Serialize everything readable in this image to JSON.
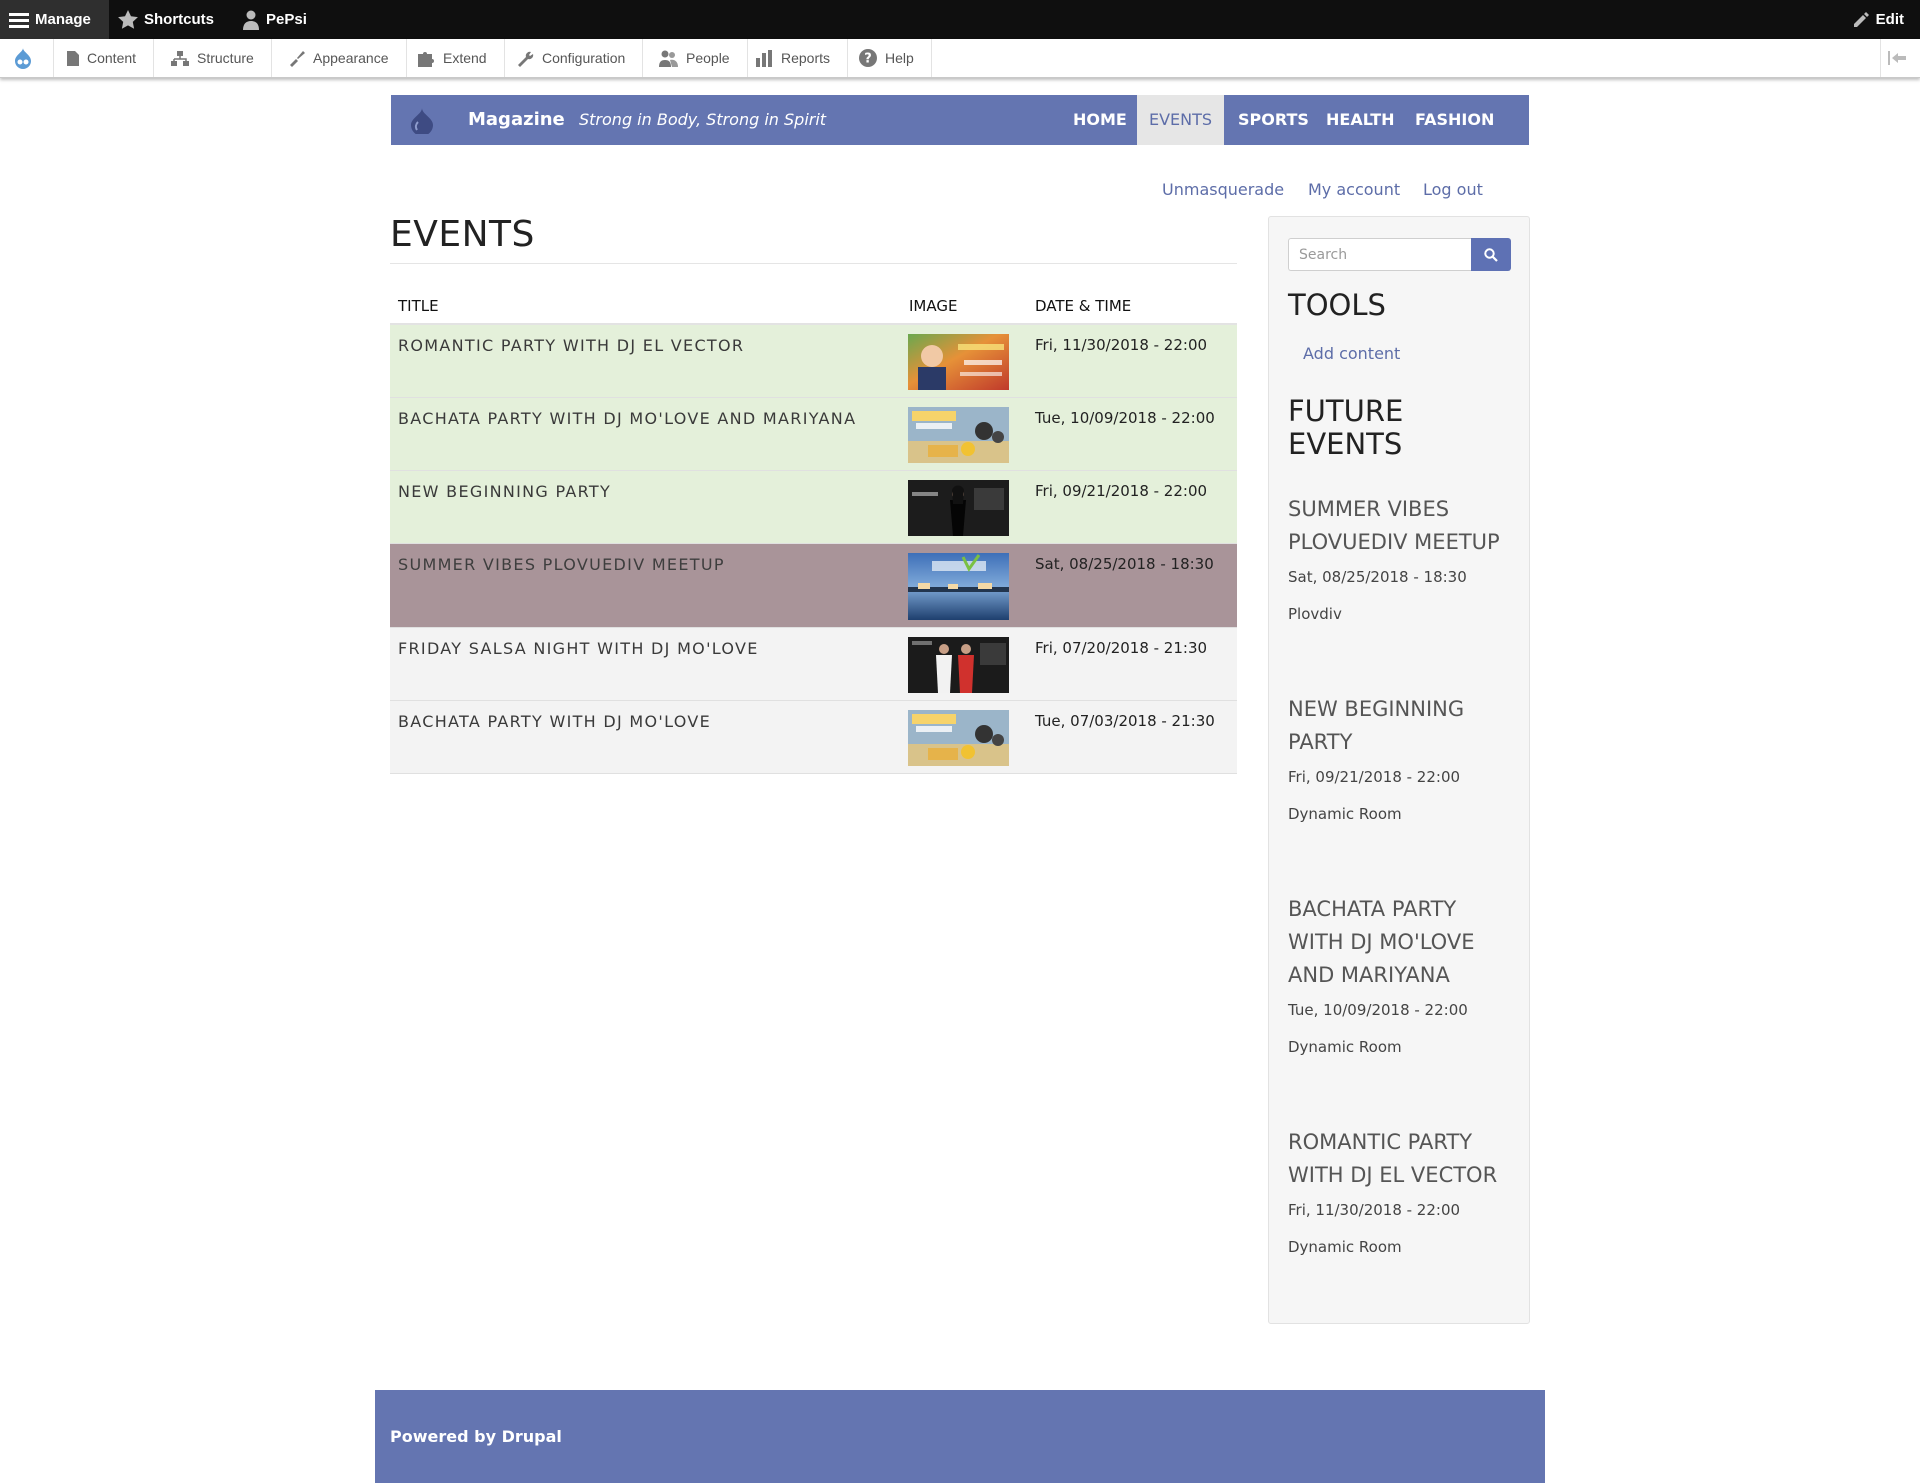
{
  "admin_bar": {
    "manage": "Manage",
    "shortcuts": "Shortcuts",
    "user": "PePsi",
    "edit": "Edit"
  },
  "admin_tray": {
    "items": [
      "Content",
      "Structure",
      "Appearance",
      "Extend",
      "Configuration",
      "People",
      "Reports",
      "Help"
    ]
  },
  "site": {
    "name": "Magazine",
    "slogan": "Strong in Body, Strong in Spirit",
    "nav": [
      "HOME",
      "EVENTS",
      "SPORTS",
      "HEALTH",
      "FASHION"
    ],
    "active_nav": "EVENTS"
  },
  "secondary_menu": [
    "Unmasquerade",
    "My account",
    "Log out"
  ],
  "page": {
    "title": "EVENTS"
  },
  "table": {
    "headers": [
      "TITLE",
      "IMAGE",
      "DATE & TIME"
    ],
    "rows": [
      {
        "title": "Romantic Party with DJ El Vector",
        "date": "Fri, 11/30/2018 - 22:00",
        "status": "upcoming"
      },
      {
        "title": "Bachata Party with DJ Mo'Love and Mariyana",
        "date": "Tue, 10/09/2018 - 22:00",
        "status": "upcoming"
      },
      {
        "title": "New Beginning Party",
        "date": "Fri, 09/21/2018 - 22:00",
        "status": "upcoming"
      },
      {
        "title": "Summer Vibes Plovuediv Meetup",
        "date": "Sat, 08/25/2018 - 18:30",
        "status": "current"
      },
      {
        "title": "Friday Salsa Night with DJ Mo'Love",
        "date": "Fri, 07/20/2018 - 21:30",
        "status": "past"
      },
      {
        "title": "Bachata Party with DJ Mo'Love",
        "date": "Tue, 07/03/2018 - 21:30",
        "status": "past"
      }
    ]
  },
  "sidebar": {
    "search_placeholder": "Search",
    "tools_heading": "TOOLS",
    "add_content": "Add content",
    "future_heading": "FUTURE EVENTS",
    "future_events": [
      {
        "title": "Summer Vibes Plovuediv Meetup",
        "date": "Sat, 08/25/2018 - 18:30",
        "venue": "Plovdiv"
      },
      {
        "title": "New Beginning Party",
        "date": "Fri, 09/21/2018 - 22:00",
        "venue": "Dynamic Room"
      },
      {
        "title": "Bachata Party with DJ Mo'Love and Mariyana",
        "date": "Tue, 10/09/2018 - 22:00",
        "venue": "Dynamic Room"
      },
      {
        "title": "Romantic Party with DJ El Vector",
        "date": "Fri, 11/30/2018 - 22:00",
        "venue": "Dynamic Room"
      }
    ]
  },
  "footer": {
    "powered": "Powered by Drupal"
  },
  "colors": {
    "brand": "#6475b1",
    "link": "#5d6da8",
    "row_upcoming": "#e4f0da",
    "row_current": "#a99499",
    "row_past": "#f3f3f3"
  }
}
